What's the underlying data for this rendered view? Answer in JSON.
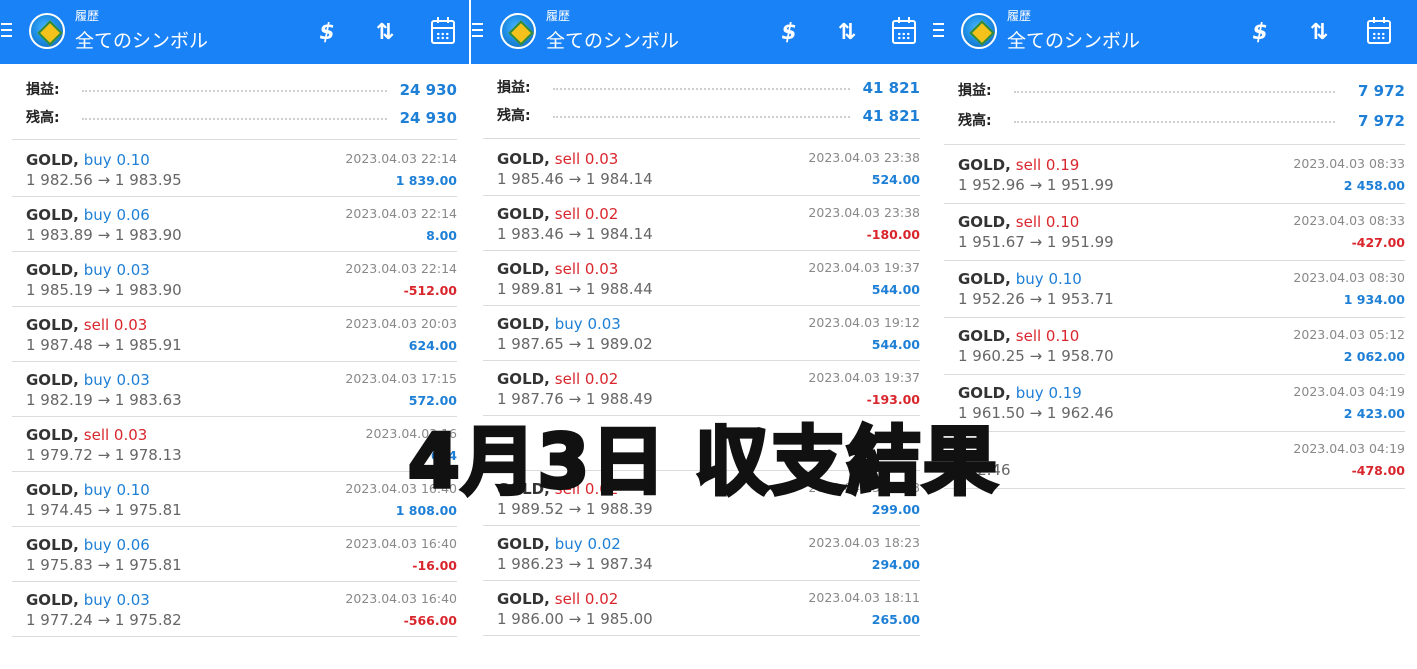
{
  "panels": [
    {
      "header": {
        "subtitle": "履歴",
        "title": "全てのシンボル",
        "icons": [
          "dollar-icon",
          "sort-icon",
          "calendar-icon"
        ]
      },
      "summary": {
        "profit_label": "損益:",
        "profit_value": "24 930",
        "balance_label": "残高:",
        "balance_value": "24 930"
      },
      "trades": [
        {
          "symbol": "GOLD,",
          "direction": "buy 0.10",
          "side": "buy",
          "prices": "1 982.56 → 1 983.95",
          "time": "2023.04.03 22:14",
          "profit": "1 839.00"
        },
        {
          "symbol": "GOLD,",
          "direction": "buy 0.06",
          "side": "buy",
          "prices": "1 983.89 → 1 983.90",
          "time": "2023.04.03 22:14",
          "profit": "8.00"
        },
        {
          "symbol": "GOLD,",
          "direction": "buy 0.03",
          "side": "buy",
          "prices": "1 985.19 → 1 983.90",
          "time": "2023.04.03 22:14",
          "profit": "-512.00"
        },
        {
          "symbol": "GOLD,",
          "direction": "sell 0.03",
          "side": "sell",
          "prices": "1 987.48 → 1 985.91",
          "time": "2023.04.03 20:03",
          "profit": "624.00"
        },
        {
          "symbol": "GOLD,",
          "direction": "buy 0.03",
          "side": "buy",
          "prices": "1 982.19 → 1 983.63",
          "time": "2023.04.03 17:15",
          "profit": "572.00"
        },
        {
          "symbol": "GOLD,",
          "direction": "sell 0.03",
          "side": "sell",
          "prices": "1 979.72 → 1 978.13",
          "time": "2023.04.03 16",
          "profit": "634"
        },
        {
          "symbol": "GOLD,",
          "direction": "buy 0.10",
          "side": "buy",
          "prices": "1 974.45 → 1 975.81",
          "time": "2023.04.03 16:40",
          "profit": "1 808.00"
        },
        {
          "symbol": "GOLD,",
          "direction": "buy 0.06",
          "side": "buy",
          "prices": "1 975.83 → 1 975.81",
          "time": "2023.04.03 16:40",
          "profit": "-16.00"
        },
        {
          "symbol": "GOLD,",
          "direction": "buy 0.03",
          "side": "buy",
          "prices": "1 977.24 → 1 975.82",
          "time": "2023.04.03 16:40",
          "profit": "-566.00"
        }
      ]
    },
    {
      "header": {
        "subtitle": "履歴",
        "title": "全てのシンボル",
        "icons": [
          "dollar-icon",
          "sort-icon",
          "calendar-icon"
        ]
      },
      "summary": {
        "profit_label": "損益:",
        "profit_value": "41 821",
        "balance_label": "残高:",
        "balance_value": "41 821"
      },
      "trades": [
        {
          "symbol": "GOLD,",
          "direction": "sell 0.03",
          "side": "sell",
          "prices": "1 985.46 → 1 984.14",
          "time": "2023.04.03 23:38",
          "profit": "524.00"
        },
        {
          "symbol": "GOLD,",
          "direction": "sell 0.02",
          "side": "sell",
          "prices": "1 983.46 → 1 984.14",
          "time": "2023.04.03 23:38",
          "profit": "-180.00"
        },
        {
          "symbol": "GOLD,",
          "direction": "sell 0.03",
          "side": "sell",
          "prices": "1 989.81 → 1 988.44",
          "time": "2023.04.03 19:37",
          "profit": "544.00"
        },
        {
          "symbol": "GOLD,",
          "direction": "buy 0.03",
          "side": "buy",
          "prices": "1 987.65 → 1 989.02",
          "time": "2023.04.03 19:12",
          "profit": "544.00"
        },
        {
          "symbol": "GOLD,",
          "direction": "sell 0.02",
          "side": "sell",
          "prices": "1 987.76 → 1 988.49",
          "time": "2023.04.03 19:37",
          "profit": "-193.00"
        },
        {
          "symbol": "",
          "direction": "",
          "side": "buy",
          "prices": "",
          "time": "",
          "profit": ""
        },
        {
          "symbol": "GOLD,",
          "direction": "sell 0.02",
          "side": "sell",
          "prices": "1 989.52 → 1 988.39",
          "time": "2023.04.03 16:38",
          "profit": "299.00"
        },
        {
          "symbol": "GOLD,",
          "direction": "buy 0.02",
          "side": "buy",
          "prices": "1 986.23 → 1 987.34",
          "time": "2023.04.03 18:23",
          "profit": "294.00"
        },
        {
          "symbol": "GOLD,",
          "direction": "sell 0.02",
          "side": "sell",
          "prices": "1 986.00 → 1 985.00",
          "time": "2023.04.03 18:11",
          "profit": "265.00"
        }
      ]
    },
    {
      "header": {
        "subtitle": "履歴",
        "title": "全てのシンボル",
        "icons": [
          "dollar-icon",
          "sort-icon",
          "calendar-icon"
        ]
      },
      "summary": {
        "profit_label": "損益:",
        "profit_value": "7 972",
        "balance_label": "残高:",
        "balance_value": "7 972"
      },
      "trades": [
        {
          "symbol": "GOLD,",
          "direction": "sell 0.19",
          "side": "sell",
          "prices": "1 952.96 → 1 951.99",
          "time": "2023.04.03 08:33",
          "profit": "2 458.00"
        },
        {
          "symbol": "GOLD,",
          "direction": "sell 0.10",
          "side": "sell",
          "prices": "1 951.67 → 1 951.99",
          "time": "2023.04.03 08:33",
          "profit": "-427.00"
        },
        {
          "symbol": "GOLD,",
          "direction": "buy 0.10",
          "side": "buy",
          "prices": "1 952.26 → 1 953.71",
          "time": "2023.04.03 08:30",
          "profit": "1 934.00"
        },
        {
          "symbol": "GOLD,",
          "direction": "sell 0.10",
          "side": "sell",
          "prices": "1 960.25 → 1 958.70",
          "time": "2023.04.03 05:12",
          "profit": "2 062.00"
        },
        {
          "symbol": "GOLD,",
          "direction": "buy 0.19",
          "side": "buy",
          "prices": "1 961.50 → 1 962.46",
          "time": "2023.04.03 04:19",
          "profit": "2 423.00"
        },
        {
          "symbol": "",
          "direction": "",
          "side": "buy",
          "prices": "962.46",
          "time": "2023.04.03 04:19",
          "profit": "-478.00"
        }
      ]
    }
  ],
  "overlay": {
    "text": "4月3日 収支結果"
  },
  "colors": {
    "appbar": "#1a82f7",
    "buy": "#1e7fd6",
    "sell": "#d9262d",
    "profit_positive": "#1e7fd6",
    "profit_negative": "#d9262d"
  }
}
